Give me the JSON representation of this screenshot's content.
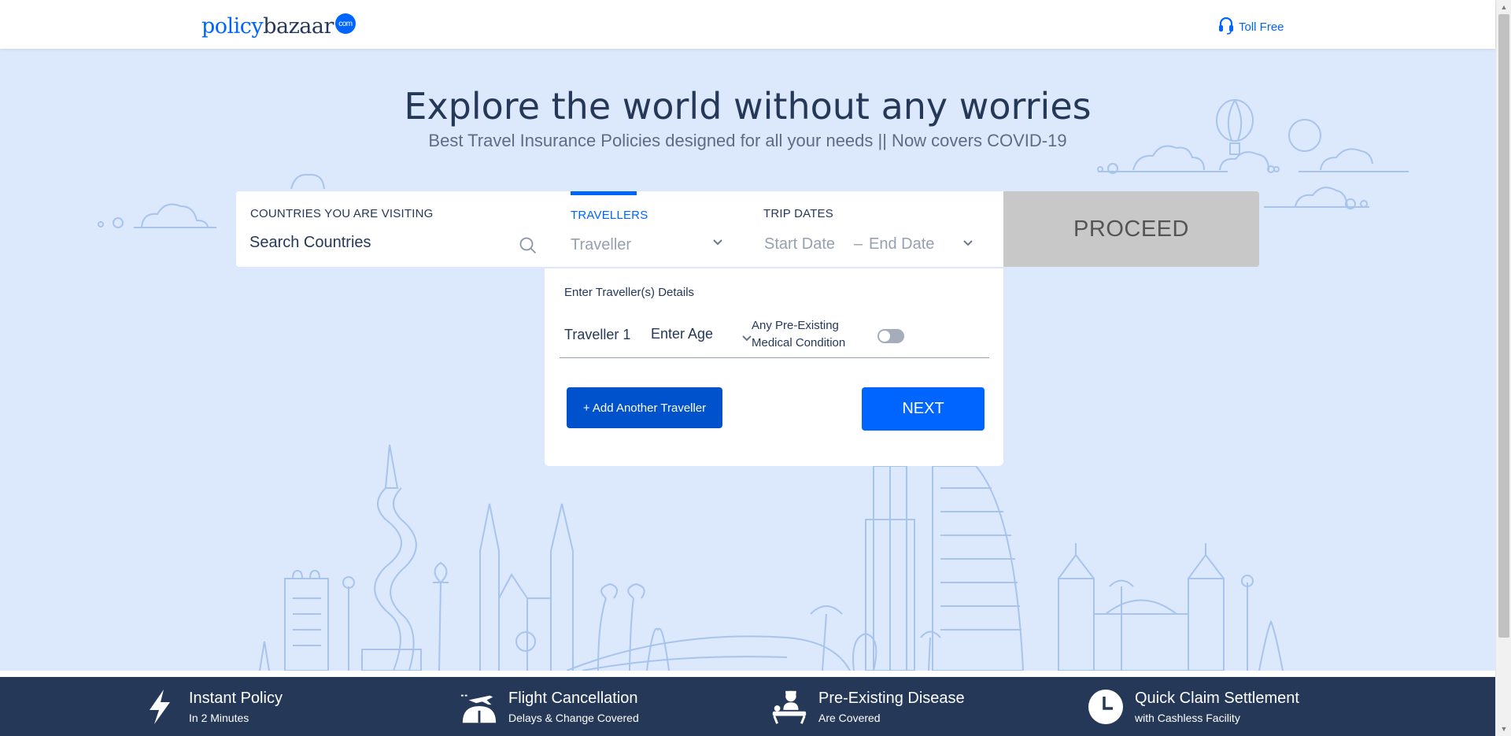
{
  "header": {
    "logo_part1": "policy",
    "logo_part2": "bazaar",
    "logo_suffix": "com",
    "toll_free": "Toll Free"
  },
  "hero": {
    "title": "Explore the world without any worries",
    "subtitle": "Best Travel Insurance Policies designed for all your needs || Now covers COVID-19"
  },
  "form": {
    "countries_label": "COUNTRIES YOU ARE VISITING",
    "countries_placeholder": "Search Countries",
    "travellers_label": "TRAVELLERS",
    "traveller_placeholder": "Traveller",
    "trip_dates_label": "TRIP DATES",
    "start_date": "Start Date",
    "date_separator": "–",
    "end_date": "End Date",
    "proceed_label": "PROCEED"
  },
  "traveller_panel": {
    "title": "Enter Traveller(s) Details",
    "traveller_label": "Traveller 1",
    "age_placeholder": "Enter Age",
    "pre_existing_line1": "Any Pre-Existing",
    "pre_existing_line2": "Medical Condition",
    "add_button": "+ Add Another Traveller",
    "next_button": "NEXT"
  },
  "features": [
    {
      "title": "Instant Policy",
      "subtitle": "In 2 Minutes",
      "icon": "lightning-icon"
    },
    {
      "title": "Flight Cancellation",
      "subtitle": "Delays & Change Covered",
      "icon": "plane-icon"
    },
    {
      "title": "Pre-Existing Disease",
      "subtitle": "Are Covered",
      "icon": "doctor-icon"
    },
    {
      "title": "Quick Claim Settlement",
      "subtitle": "with Cashless Facility",
      "icon": "clock-icon"
    }
  ],
  "colors": {
    "brand_blue": "#0065ff",
    "dark_blue": "#0052cc",
    "navy": "#253858",
    "hero_bg": "#dce8fb"
  }
}
